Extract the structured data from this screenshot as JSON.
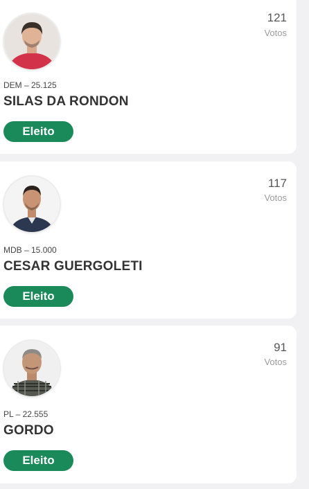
{
  "votes_label": "Votos",
  "candidates": [
    {
      "votes": "121",
      "party": "DEM – 25.125",
      "name": "SILAS DA RONDON",
      "status": "Eleito"
    },
    {
      "votes": "117",
      "party": "MDB – 15.000",
      "name": "CESAR GUERGOLETI",
      "status": "Eleito"
    },
    {
      "votes": "91",
      "party": "PL – 22.555",
      "name": "GORDO",
      "status": "Eleito"
    }
  ],
  "colors": {
    "badge": "#1a8a5a",
    "card": "#ffffff",
    "background": "#f1f1f3"
  }
}
